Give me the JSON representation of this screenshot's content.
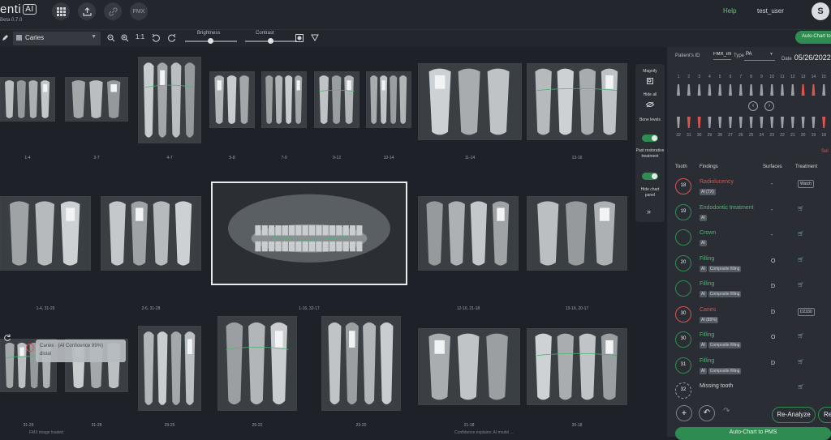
{
  "app": {
    "logo_text": "enti",
    "logo_badge": "AI",
    "version": "Beta 0.7.0"
  },
  "topbar": {
    "fmx_label": "FMX",
    "help": "Help",
    "user": "test_user",
    "avatar_letter": "S"
  },
  "toolbar": {
    "finding_select": "Caries",
    "zoom_reset": "1:1",
    "brightness_label": "Brightness",
    "brightness_value": 0.5,
    "contrast_label": "Contrast",
    "contrast_value": 0.5,
    "auto_chart_label": "Auto-Chart to"
  },
  "images": [
    {
      "label": "1-4"
    },
    {
      "label": "3-7"
    },
    {
      "label": "4-7"
    },
    {
      "label": "5-8"
    },
    {
      "label": "7-9"
    },
    {
      "label": "9-12"
    },
    {
      "label": "10-14"
    },
    {
      "label": "11-14"
    },
    {
      "label": "13-16"
    },
    {
      "label": "1-4, 31-29"
    },
    {
      "label": "2-6, 31-28"
    },
    {
      "label": "1-16, 32-17"
    },
    {
      "label": "12-16, 21-18"
    },
    {
      "label": "13-16, 20-17"
    },
    {
      "label": "31-29"
    },
    {
      "label": "31-28"
    },
    {
      "label": "29-25"
    },
    {
      "label": "26-22"
    },
    {
      "label": "23-20"
    },
    {
      "label": "21-18"
    },
    {
      "label": "20-18"
    }
  ],
  "tooltip": {
    "line1": "Caries · (AI Confidence 89%)",
    "line2": "distal"
  },
  "side_tools": {
    "magnify": "Magnify",
    "hide_all": "Hide all",
    "bone_levels": "Bone levels",
    "past_restorative": "Past restorative treatment",
    "hide_chart": "Hide chart panel"
  },
  "chart_panel": {
    "patient_id_label": "Patient's ID",
    "patient_id_value": "FMX_imag",
    "type_label": "Type",
    "type_value": "PA",
    "date_label": "Date",
    "date_value": "05/26/2022",
    "upper_numbers": [
      "1",
      "2",
      "3",
      "4",
      "5",
      "6",
      "7",
      "8",
      "9",
      "10",
      "11",
      "12",
      "13",
      "14",
      "15"
    ],
    "lower_numbers": [
      "32",
      "31",
      "30",
      "29",
      "28",
      "27",
      "26",
      "25",
      "24",
      "23",
      "22",
      "21",
      "20",
      "19",
      "18"
    ],
    "select_link": "Sel",
    "headers": {
      "tooth": "Tooth",
      "findings": "Findings",
      "surfaces": "Surfaces",
      "treatment": "Treatment"
    },
    "rows": [
      {
        "tooth": "18",
        "finding": "Radiolucency",
        "badges": [
          "AI (TX)"
        ],
        "surfaces": "-",
        "treatment": "Watch",
        "style": "red"
      },
      {
        "tooth": "19",
        "finding": "Endodontic treatment",
        "badges": [
          "AI"
        ],
        "surfaces": "-",
        "treatment": "",
        "style": "green"
      },
      {
        "tooth": "",
        "finding": "Crown",
        "badges": [
          "AI"
        ],
        "surfaces": "-",
        "treatment": "",
        "style": "green"
      },
      {
        "tooth": "20",
        "finding": "Filling",
        "badges": [
          "AI",
          "Composite filling"
        ],
        "surfaces": "O",
        "treatment": "",
        "style": "green"
      },
      {
        "tooth": "",
        "finding": "Filling",
        "badges": [
          "AI",
          "Composite filling"
        ],
        "surfaces": "D",
        "treatment": "",
        "style": "green"
      },
      {
        "tooth": "30",
        "finding": "Caries",
        "badges": [
          "AI (89%)"
        ],
        "surfaces": "D",
        "treatment": "D2330",
        "style": "red"
      },
      {
        "tooth": "30",
        "finding": "Filling",
        "badges": [
          "AI",
          "Composite filling"
        ],
        "surfaces": "O",
        "treatment": "",
        "style": "green"
      },
      {
        "tooth": "31",
        "finding": "Filling",
        "badges": [
          "AI",
          "Composite filling"
        ],
        "surfaces": "D",
        "treatment": "",
        "style": "green"
      },
      {
        "tooth": "32",
        "finding": "Missing tooth",
        "badges": [],
        "surfaces": "",
        "treatment": "",
        "style": "grey"
      }
    ],
    "reanalyze": "Re-Analyze",
    "re_partial": "Re",
    "auto_chart_bottom": "Auto-Chart to PMS"
  },
  "statusbar": {
    "left": "FMX image loaded",
    "right": "Confidence explains: AI model ..."
  }
}
